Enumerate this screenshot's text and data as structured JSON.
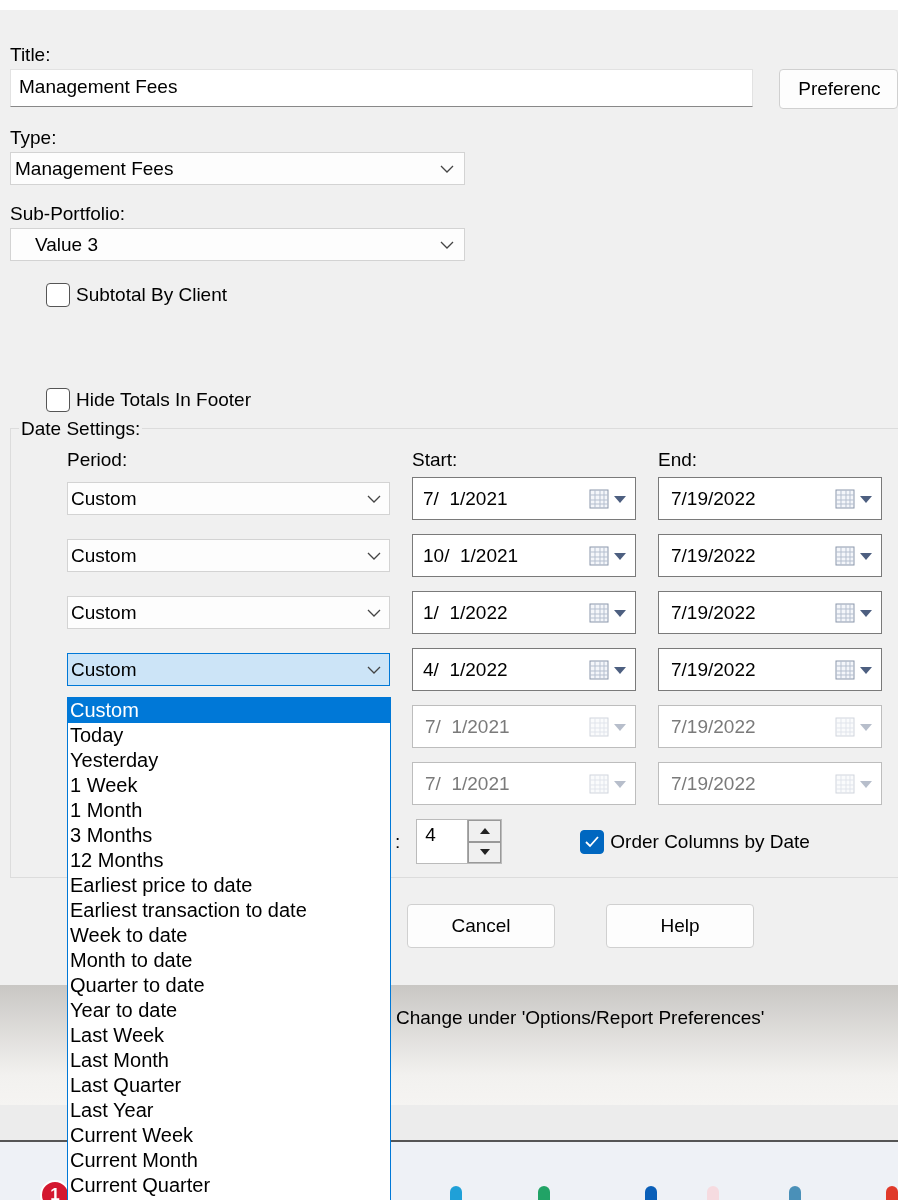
{
  "title_field": {
    "label": "Title:",
    "value": "Management Fees"
  },
  "preferences_button": "Preferenc",
  "type_field": {
    "label": "Type:",
    "value": "Management Fees"
  },
  "sub_portfolio_field": {
    "label": "Sub-Portfolio:",
    "value": "Value 3"
  },
  "checkboxes": [
    {
      "label": "Subtotal By Client",
      "checked": false
    },
    {
      "label": "Hide Totals In Footer",
      "checked": false
    }
  ],
  "date_settings": {
    "title": "Date Settings:",
    "headers": [
      "Period:",
      "Start:",
      "End:"
    ],
    "rows": [
      {
        "period": "Custom",
        "open": false,
        "start": "7/  1/2021",
        "end": "7/19/2022",
        "disabled": false
      },
      {
        "period": "Custom",
        "open": false,
        "start": "10/  1/2021",
        "end": "7/19/2022",
        "disabled": false
      },
      {
        "period": "Custom",
        "open": false,
        "start": "1/  1/2022",
        "end": "7/19/2022",
        "disabled": false
      },
      {
        "period": "Custom",
        "open": true,
        "start": "4/  1/2022",
        "end": "7/19/2022",
        "disabled": false
      },
      {
        "start": "7/  1/2021",
        "end": "7/19/2022",
        "disabled": true
      },
      {
        "start": "7/  1/2021",
        "end": "7/19/2022",
        "disabled": true
      }
    ],
    "spinner_label_tail": ":",
    "spinner_value": "4",
    "order_checkbox": {
      "label": "Order Columns by Date",
      "checked": true
    }
  },
  "buttons": [
    "Cancel",
    "Help"
  ],
  "message": "Change under 'Options/Report Preferences'",
  "period_dropdown": [
    {
      "label": "Custom",
      "selected": true
    },
    {
      "label": "Today",
      "selected": false
    },
    {
      "label": "Yesterday",
      "selected": false
    },
    {
      "label": "1 Week",
      "selected": false
    },
    {
      "label": "1 Month",
      "selected": false
    },
    {
      "label": "3 Months",
      "selected": false
    },
    {
      "label": "12 Months",
      "selected": false
    },
    {
      "label": "Earliest price to date",
      "selected": false
    },
    {
      "label": "Earliest transaction to date",
      "selected": false
    },
    {
      "label": "Week to date",
      "selected": false
    },
    {
      "label": "Month to date",
      "selected": false
    },
    {
      "label": "Quarter to date",
      "selected": false
    },
    {
      "label": "Year to date",
      "selected": false
    },
    {
      "label": "Last Week",
      "selected": false
    },
    {
      "label": "Last Month",
      "selected": false
    },
    {
      "label": "Last Quarter",
      "selected": false
    },
    {
      "label": "Last Year",
      "selected": false
    },
    {
      "label": "Current Week",
      "selected": false
    },
    {
      "label": "Current Month",
      "selected": false
    },
    {
      "label": "Current Quarter",
      "selected": false
    }
  ],
  "taskbar": {
    "badge": "1"
  }
}
